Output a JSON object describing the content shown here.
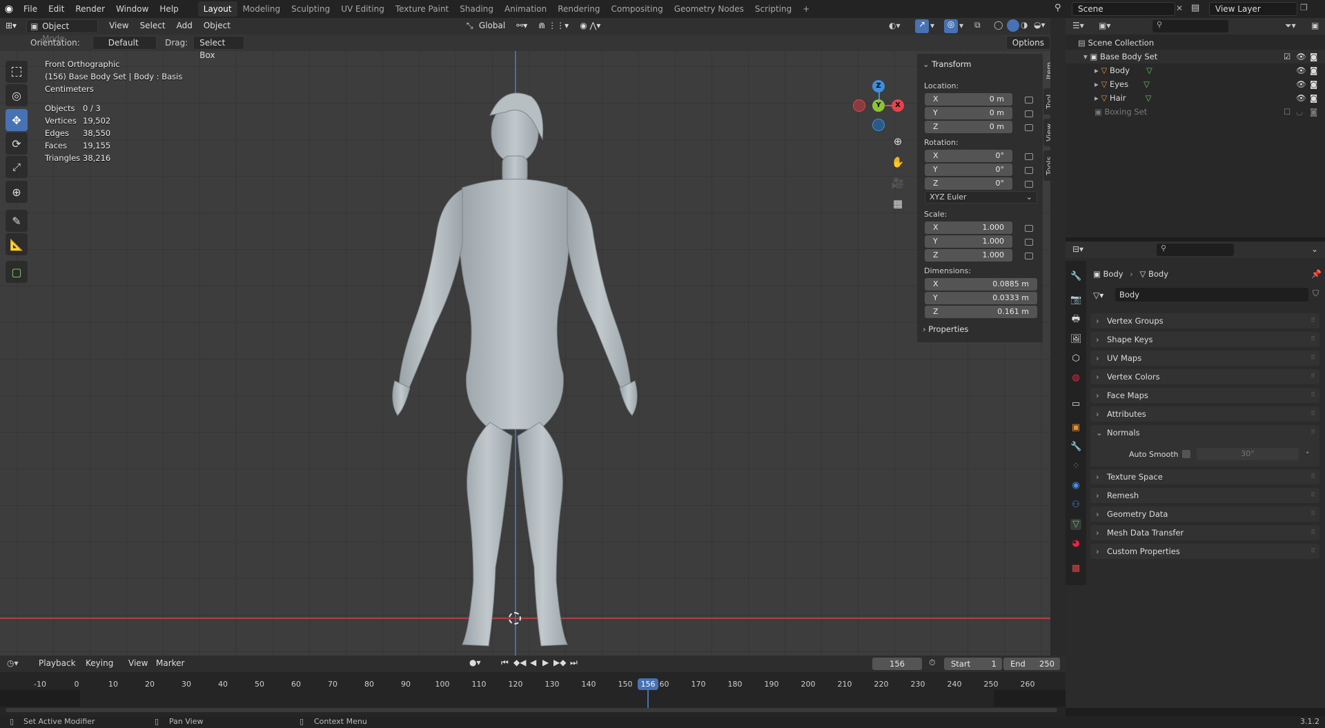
{
  "topbar": {
    "menus": [
      "File",
      "Edit",
      "Render",
      "Window",
      "Help"
    ],
    "workspaces": [
      "Layout",
      "Modeling",
      "Sculpting",
      "UV Editing",
      "Texture Paint",
      "Shading",
      "Animation",
      "Rendering",
      "Compositing",
      "Geometry Nodes",
      "Scripting"
    ],
    "active_workspace": "Layout",
    "add_tab": "+",
    "scene": "Scene",
    "view_layer": "View Layer"
  },
  "viewport": {
    "mode": "Object Mode",
    "menus": [
      "View",
      "Select",
      "Add",
      "Object"
    ],
    "transform_orientation": "Global",
    "orientation_label": "Orientation:",
    "orientation_value": "Default",
    "drag_label": "Drag:",
    "drag_value": "Select Box",
    "options": "Options",
    "overlay": {
      "view_name": "Front Orthographic",
      "context": "(156) Base Body Set | Body : Basis",
      "units": "Centimeters",
      "stats": [
        {
          "label": "Objects",
          "value": "0 / 3"
        },
        {
          "label": "Vertices",
          "value": "19,502"
        },
        {
          "label": "Edges",
          "value": "38,550"
        },
        {
          "label": "Faces",
          "value": "19,155"
        },
        {
          "label": "Triangles",
          "value": "38,216"
        }
      ]
    },
    "gizmo": {
      "x": "X",
      "y": "Y",
      "z": "Z"
    },
    "tabs": [
      "Item",
      "Tool",
      "View",
      "Tools"
    ]
  },
  "npanel": {
    "title": "Transform",
    "location_label": "Location:",
    "location": [
      {
        "axis": "X",
        "value": "0 m"
      },
      {
        "axis": "Y",
        "value": "0 m"
      },
      {
        "axis": "Z",
        "value": "0 m"
      }
    ],
    "rotation_label": "Rotation:",
    "rotation": [
      {
        "axis": "X",
        "value": "0°"
      },
      {
        "axis": "Y",
        "value": "0°"
      },
      {
        "axis": "Z",
        "value": "0°"
      }
    ],
    "rotation_mode": "XYZ Euler",
    "scale_label": "Scale:",
    "scale": [
      {
        "axis": "X",
        "value": "1.000"
      },
      {
        "axis": "Y",
        "value": "1.000"
      },
      {
        "axis": "Z",
        "value": "1.000"
      }
    ],
    "dimensions_label": "Dimensions:",
    "dimensions": [
      {
        "axis": "X",
        "value": "0.0885 m"
      },
      {
        "axis": "Y",
        "value": "0.0333 m"
      },
      {
        "axis": "Z",
        "value": "0.161 m"
      }
    ],
    "properties": "Properties"
  },
  "outliner": {
    "root": "Scene Collection",
    "collection": "Base Body Set",
    "objects": [
      "Body",
      "Eyes",
      "Hair"
    ],
    "other_collection": "Boxing Set"
  },
  "properties": {
    "breadcrumb_object": "Body",
    "breadcrumb_data": "Body",
    "mesh_name": "Body",
    "sections": [
      "Vertex Groups",
      "Shape Keys",
      "UV Maps",
      "Vertex Colors",
      "Face Maps",
      "Attributes",
      "Normals"
    ],
    "auto_smooth_label": "Auto Smooth",
    "auto_smooth_angle": "30°",
    "sections_after": [
      "Texture Space",
      "Remesh",
      "Geometry Data",
      "Mesh Data Transfer",
      "Custom Properties"
    ]
  },
  "timeline": {
    "menus": [
      "Playback",
      "Keying",
      "View",
      "Marker"
    ],
    "current_frame": "156",
    "start_label": "Start",
    "start": "1",
    "end_label": "End",
    "end": "250",
    "ticks": [
      "-10",
      "0",
      "10",
      "20",
      "30",
      "40",
      "50",
      "60",
      "70",
      "80",
      "90",
      "100",
      "110",
      "120",
      "130",
      "140",
      "150",
      "160",
      "170",
      "180",
      "190",
      "200",
      "210",
      "220",
      "230",
      "240",
      "250",
      "260"
    ]
  },
  "statusbar": {
    "left": "Set Active Modifier",
    "middle": "Pan View",
    "right": "Context Menu",
    "version": "3.1.2"
  },
  "colors": {
    "accent": "#4772b3",
    "x_axis": "#e5434f",
    "y_axis": "#8cc530",
    "z_axis": "#3d8fdc",
    "mesh": "#b4bdc2"
  }
}
